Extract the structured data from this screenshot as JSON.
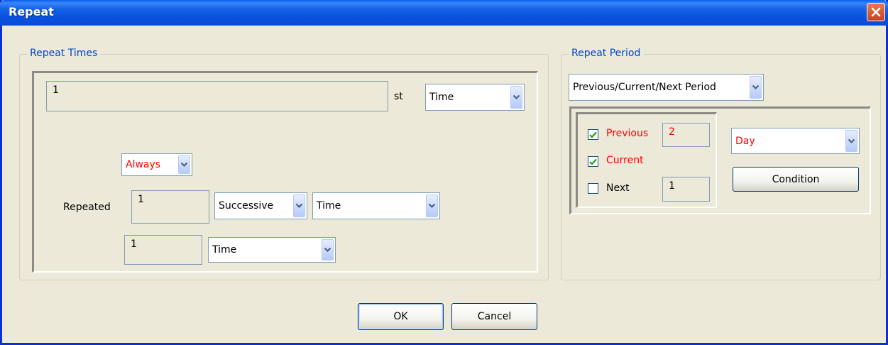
{
  "window": {
    "title": "Repeat",
    "close_icon": "close-icon"
  },
  "repeat_times": {
    "legend": "Repeat Times",
    "count_value": "1",
    "ordinal_suffix": "st",
    "unit_select": "Time",
    "mode_select": "Always",
    "repeated_label": "Repeated",
    "repeated_value": "1",
    "succession_select": "Successive",
    "repeated_unit_select": "Time",
    "interval_value": "1",
    "interval_unit_select": "Time"
  },
  "repeat_period": {
    "legend": "Repeat Period",
    "period_select": "Previous/Current/Next Period",
    "previous": {
      "label": "Previous",
      "checked": true,
      "value": "2"
    },
    "current": {
      "label": "Current",
      "checked": true
    },
    "next": {
      "label": "Next",
      "checked": false,
      "value": "1"
    },
    "period_unit_select": "Day",
    "condition_label": "Condition"
  },
  "footer": {
    "ok_label": "OK",
    "cancel_label": "Cancel"
  },
  "colors": {
    "accent": "#0046d5",
    "highlight_red": "#ff0000",
    "title_blue": "#0a5ef0"
  }
}
